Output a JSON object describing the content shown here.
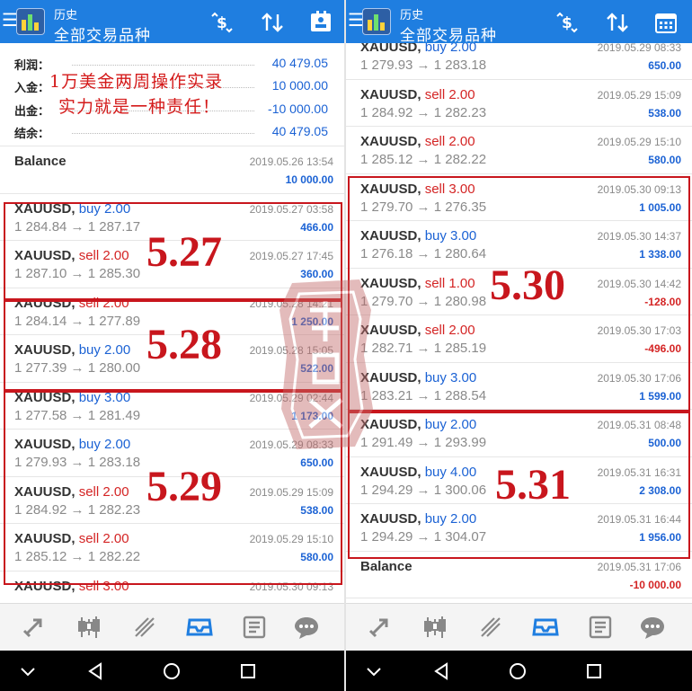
{
  "app": {
    "header_top": "历史",
    "header_title": "全部交易品种",
    "brand_color": "#1f7ee0"
  },
  "overlays": {
    "caption1": "1万美金两周操作实录",
    "caption2": "实力就是一种责任！",
    "dates": [
      "5.27",
      "5.28",
      "5.29",
      "5.30",
      "5.31"
    ],
    "stamp_text": "金融"
  },
  "summary": [
    {
      "label": "利润：",
      "value": "40 479.05"
    },
    {
      "label": "入金：",
      "value": "10 000.00"
    },
    {
      "label": "出金：",
      "value": "-10 000.00"
    },
    {
      "label": "结余：",
      "value": "40 479.05"
    }
  ],
  "left_list": [
    {
      "kind": "balance",
      "symbol": "Balance",
      "date": "2019.05.26 13:54",
      "pnl": "10 000.00"
    },
    {
      "symbol": "XAUUSD,",
      "action": "buy 2.00",
      "side": "buy",
      "price": "1 284.84 → 1 287.17",
      "date": "2019.05.27 03:58",
      "pnl": "466.00"
    },
    {
      "symbol": "XAUUSD,",
      "action": "sell 2.00",
      "side": "sell",
      "price": "1 287.10 → 1 285.30",
      "date": "2019.05.27 17:45",
      "pnl": "360.00"
    },
    {
      "symbol": "XAUUSD,",
      "action": "sell 2.00",
      "side": "sell",
      "price": "1 284.14 → 1 277.89",
      "date": "2019.05.28 14:21",
      "pnl": "1 250.00"
    },
    {
      "symbol": "XAUUSD,",
      "action": "buy 2.00",
      "side": "buy",
      "price": "1 277.39 → 1 280.00",
      "date": "2019.05.28 15:05",
      "pnl": "522.00"
    },
    {
      "symbol": "XAUUSD,",
      "action": "buy 3.00",
      "side": "buy",
      "price": "1 277.58 → 1 281.49",
      "date": "2019.05.29 02:44",
      "pnl": "1 173.00"
    },
    {
      "symbol": "XAUUSD,",
      "action": "buy 2.00",
      "side": "buy",
      "price": "1 279.93 → 1 283.18",
      "date": "2019.05.29 08:33",
      "pnl": "650.00"
    },
    {
      "symbol": "XAUUSD,",
      "action": "sell 2.00",
      "side": "sell",
      "price": "1 284.92 → 1 282.23",
      "date": "2019.05.29 15:09",
      "pnl": "538.00"
    },
    {
      "symbol": "XAUUSD,",
      "action": "sell 2.00",
      "side": "sell",
      "price": "1 285.12 → 1 282.22",
      "date": "2019.05.29 15:10",
      "pnl": "580.00"
    },
    {
      "symbol": "XAUUSD,",
      "action": "sell 3.00",
      "side": "sell",
      "price": "",
      "date": "2019.05.30 09:13",
      "pnl": ""
    }
  ],
  "right_list": [
    {
      "symbol": "XAUUSD,",
      "action": "buy 2.00",
      "side": "buy",
      "price": "1 279.93 → 1 283.18",
      "date": "2019.05.29 08:33",
      "pnl": "650.00"
    },
    {
      "symbol": "XAUUSD,",
      "action": "sell 2.00",
      "side": "sell",
      "price": "1 284.92 → 1 282.23",
      "date": "2019.05.29 15:09",
      "pnl": "538.00"
    },
    {
      "symbol": "XAUUSD,",
      "action": "sell 2.00",
      "side": "sell",
      "price": "1 285.12 → 1 282.22",
      "date": "2019.05.29 15:10",
      "pnl": "580.00"
    },
    {
      "symbol": "XAUUSD,",
      "action": "sell 3.00",
      "side": "sell",
      "price": "1 279.70 → 1 276.35",
      "date": "2019.05.30 09:13",
      "pnl": "1 005.00"
    },
    {
      "symbol": "XAUUSD,",
      "action": "buy 3.00",
      "side": "buy",
      "price": "1 276.18 → 1 280.64",
      "date": "2019.05.30 14:37",
      "pnl": "1 338.00"
    },
    {
      "symbol": "XAUUSD,",
      "action": "sell 1.00",
      "side": "sell",
      "price": "1 279.70 → 1 280.98",
      "date": "2019.05.30 14:42",
      "pnl": "-128.00"
    },
    {
      "symbol": "XAUUSD,",
      "action": "sell 2.00",
      "side": "sell",
      "price": "1 282.71 → 1 285.19",
      "date": "2019.05.30 17:03",
      "pnl": "-496.00"
    },
    {
      "symbol": "XAUUSD,",
      "action": "buy 3.00",
      "side": "buy",
      "price": "1 283.21 → 1 288.54",
      "date": "2019.05.30 17:06",
      "pnl": "1 599.00"
    },
    {
      "symbol": "XAUUSD,",
      "action": "buy 2.00",
      "side": "buy",
      "price": "1 291.49 → 1 293.99",
      "date": "2019.05.31 08:48",
      "pnl": "500.00"
    },
    {
      "symbol": "XAUUSD,",
      "action": "buy 4.00",
      "side": "buy",
      "price": "1 294.29 → 1 300.06",
      "date": "2019.05.31 16:31",
      "pnl": "2 308.00"
    },
    {
      "symbol": "XAUUSD,",
      "action": "buy 2.00",
      "side": "buy",
      "price": "1 294.29 → 1 304.07",
      "date": "2019.05.31 16:44",
      "pnl": "1 956.00"
    },
    {
      "kind": "balance",
      "symbol": "Balance",
      "date": "2019.05.31 17:06",
      "pnl": "-10 000.00"
    }
  ],
  "tabbar": [
    "quotes-icon",
    "chart-icon",
    "trade-icon",
    "history-icon",
    "news-icon",
    "chat-icon"
  ],
  "sysbar": [
    "down-chevron-icon",
    "back-icon",
    "home-icon",
    "recents-icon"
  ]
}
